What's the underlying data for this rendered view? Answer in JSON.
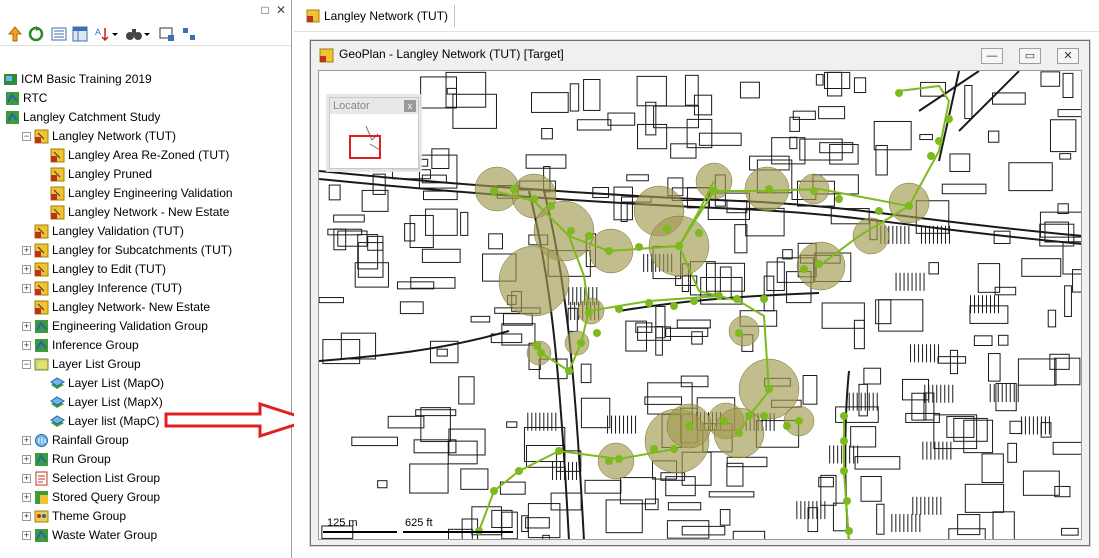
{
  "left_panel": {
    "caption_buttons": [
      "□",
      "✕"
    ],
    "toolbar_icons": [
      "up-arrow-icon",
      "refresh-icon",
      "properties-icon",
      "tables-icon",
      "sort-icon",
      "dropdown-arrow-icon",
      "find-icon",
      "dropdown-arrow-icon",
      "network-icon",
      "pointer-icon"
    ],
    "tree": [
      {
        "label": "ICM Basic Training 2019",
        "level": 0,
        "expander": "",
        "icon": "database-icon"
      },
      {
        "label": "RTC",
        "level": 0,
        "expander": "+",
        "icon": "green-map-icon"
      },
      {
        "label": "Langley Catchment Study",
        "level": 0,
        "expander": "−",
        "icon": "green-map-icon"
      },
      {
        "label": "Langley Network (TUT)",
        "level": 1,
        "expander": "−",
        "icon": "network-icon"
      },
      {
        "label": "Langley Area Re-Zoned (TUT)",
        "level": 2,
        "expander": "",
        "icon": "network-icon"
      },
      {
        "label": "Langley Pruned",
        "level": 2,
        "expander": "",
        "icon": "network-icon"
      },
      {
        "label": "Langley Engineering Validation",
        "level": 2,
        "expander": "",
        "icon": "network-icon"
      },
      {
        "label": "Langley Network - New Estate",
        "level": 2,
        "expander": "",
        "icon": "network-icon"
      },
      {
        "label": "Langley Validation (TUT)",
        "level": 1,
        "expander": "",
        "icon": "network-icon"
      },
      {
        "label": "Langley for Subcatchments (TUT)",
        "level": 1,
        "expander": "+",
        "icon": "network-icon"
      },
      {
        "label": "Langley to Edit (TUT)",
        "level": 1,
        "expander": "+",
        "icon": "network-icon"
      },
      {
        "label": "Langley Inference (TUT)",
        "level": 1,
        "expander": "+",
        "icon": "network-icon"
      },
      {
        "label": "Langley Network- New Estate",
        "level": 1,
        "expander": "",
        "icon": "network-icon"
      },
      {
        "label": "Engineering Validation Group",
        "level": 1,
        "expander": "+",
        "icon": "green-map-icon"
      },
      {
        "label": "Inference Group",
        "level": 1,
        "expander": "+",
        "icon": "green-map-icon"
      },
      {
        "label": "Layer List Group",
        "level": 1,
        "expander": "−",
        "icon": "layer-group-icon"
      },
      {
        "label": "Layer List (MapO)",
        "level": 2,
        "expander": "",
        "icon": "layer-list-icon"
      },
      {
        "label": "Layer List (MapX)",
        "level": 2,
        "expander": "",
        "icon": "layer-list-icon"
      },
      {
        "label": "Layer list (MapC)",
        "level": 2,
        "expander": "",
        "icon": "layer-list-icon"
      },
      {
        "label": "Rainfall Group",
        "level": 1,
        "expander": "+",
        "icon": "rainfall-icon"
      },
      {
        "label": "Run Group",
        "level": 1,
        "expander": "+",
        "icon": "green-map-icon"
      },
      {
        "label": "Selection List Group",
        "level": 1,
        "expander": "+",
        "icon": "selection-list-icon"
      },
      {
        "label": "Stored Query Group",
        "level": 1,
        "expander": "+",
        "icon": "stored-query-icon"
      },
      {
        "label": "Theme Group",
        "level": 1,
        "expander": "+",
        "icon": "theme-icon"
      },
      {
        "label": "Waste Water Group",
        "level": 1,
        "expander": "+",
        "icon": "green-map-icon"
      }
    ]
  },
  "document_tab": {
    "label": "Langley Network (TUT)",
    "icon": "network-icon"
  },
  "geoplan": {
    "title": "GeoPlan - Langley Network (TUT) [Target]",
    "buttons": {
      "minimize": "—",
      "restore": "▭",
      "close": "✕"
    },
    "locator": {
      "title": "Locator",
      "close": "x"
    },
    "scalebar": {
      "label_1": "125 m",
      "label_2": "625 ft"
    }
  },
  "colors": {
    "node_green": "#7cba1e",
    "buffer_olive": "#a29a4e",
    "arrow_red": "#e02020",
    "locator_frame": "#e02020"
  }
}
